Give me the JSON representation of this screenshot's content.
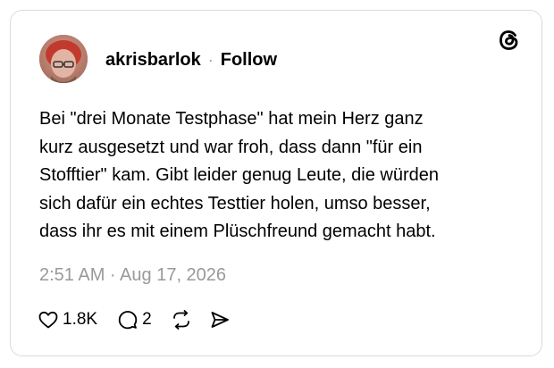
{
  "post": {
    "username": "akrisbarlok",
    "separator": "·",
    "follow_label": "Follow",
    "text": "Bei \"drei Monate Testphase\" hat mein Herz ganz\nkurz ausgesetzt und war froh,  dass dann \"für ein\nStofftier\" kam. Gibt leider genug Leute, die würden\nsich dafür ein echtes Testtier holen, umso besser,\ndass ihr es mit einem Plüschfreund gemacht habt.",
    "timestamp": "2:51 AM · Aug 17, 2026"
  },
  "actions": {
    "like_count": "1.8K",
    "reply_count": "2"
  },
  "icons": {
    "brand": "threads-icon",
    "like": "heart-icon",
    "reply": "speech-bubble-icon",
    "repost": "repost-icon",
    "share": "send-icon"
  },
  "colors": {
    "border": "#dbdbdb",
    "muted_text": "#999999",
    "text": "#000000"
  }
}
